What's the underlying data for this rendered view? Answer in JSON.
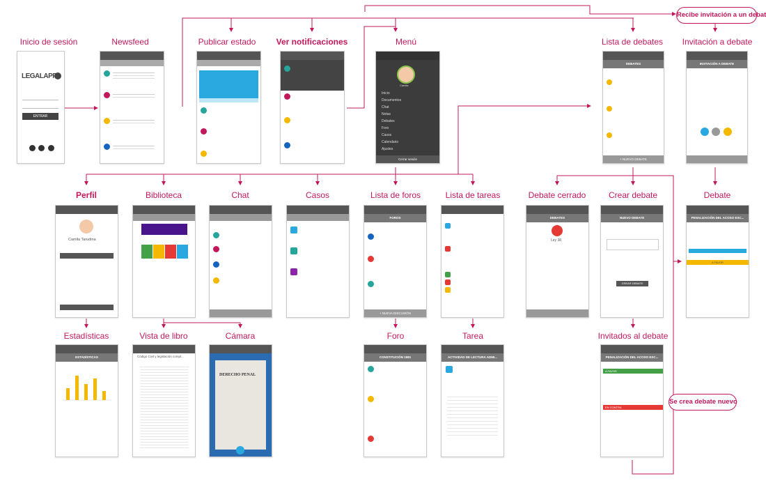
{
  "title": "",
  "nodes": {
    "inicio": "Inicio de sesión",
    "newsfeed": "Newsfeed",
    "publicar": "Publicar estado",
    "notificaciones": "Ver notificaciones",
    "menu": "Menú",
    "lista_debates": "Lista de debates",
    "invitacion": "Invitación a debate",
    "recibe": "Recibe invitación a un debate",
    "perfil": "Perfil",
    "biblioteca": "Biblioteca",
    "chat": "Chat",
    "casos": "Casos",
    "lista_foros": "Lista de foros",
    "lista_tareas": "Lista de tareas",
    "debate_cerrado": "Debate cerrado",
    "crear_debate": "Crear debate",
    "debate": "Debate",
    "estadisticas": "Estadísticas",
    "vista_libro": "Vista de libro",
    "camara": "Cámara",
    "foro": "Foro",
    "tarea": "Tarea",
    "invitados": "Invitados al debate",
    "se_crea": "Se crea debate nuevo"
  },
  "screens": {
    "login_logo": "LEGALAPP",
    "login_button": "ENTRAR",
    "menu_items": [
      "Inicio",
      "Documentos",
      "Chat",
      "Notas",
      "Debates",
      "Foro",
      "Casos",
      "Calendario",
      "Ajustes"
    ],
    "menu_footer": "Cerrar sesión",
    "menu_user": "Camila",
    "profile_name": "Camila Tarudina",
    "debates_header": "DEBATES",
    "invitation_header": "INVITACIÓN A DEBATE",
    "new_debate_header": "NUEVO DEBATE",
    "new_debate_button": "+ NUEVO DEBATE",
    "create_button": "CREAR DEBATE",
    "stats_header": "ESTADÍSTICAS",
    "foros_header": "FOROS",
    "nueva_discusion": "+ NUEVA DISCUSIÓN",
    "foro_header": "CONSTITUCIÓN 1981",
    "tarea_header": "ACTIVIDAD DE LECTURA ADMI...",
    "debate_header": "PENALIZACIÓN DEL ACOSO ESC...",
    "invitados_header": "PENALIZACIÓN DEL ACOSO ESC...",
    "book_title": "Código Civil y legislación compl...",
    "camera_book": "DERECHO PENAL",
    "debate_cerrado_user": "Ley 38",
    "debate_marker": "A FAVOR",
    "invitados_a_favor": "A FAVOR",
    "invitados_en_contra": "EN CONTRA"
  },
  "colors": {
    "accent": "#c2185b",
    "blue": "#29a9e0",
    "teal": "#26a69a",
    "yellow": "#f5b800",
    "red": "#e53935",
    "purple": "#8e24aa",
    "green": "#43a047"
  }
}
